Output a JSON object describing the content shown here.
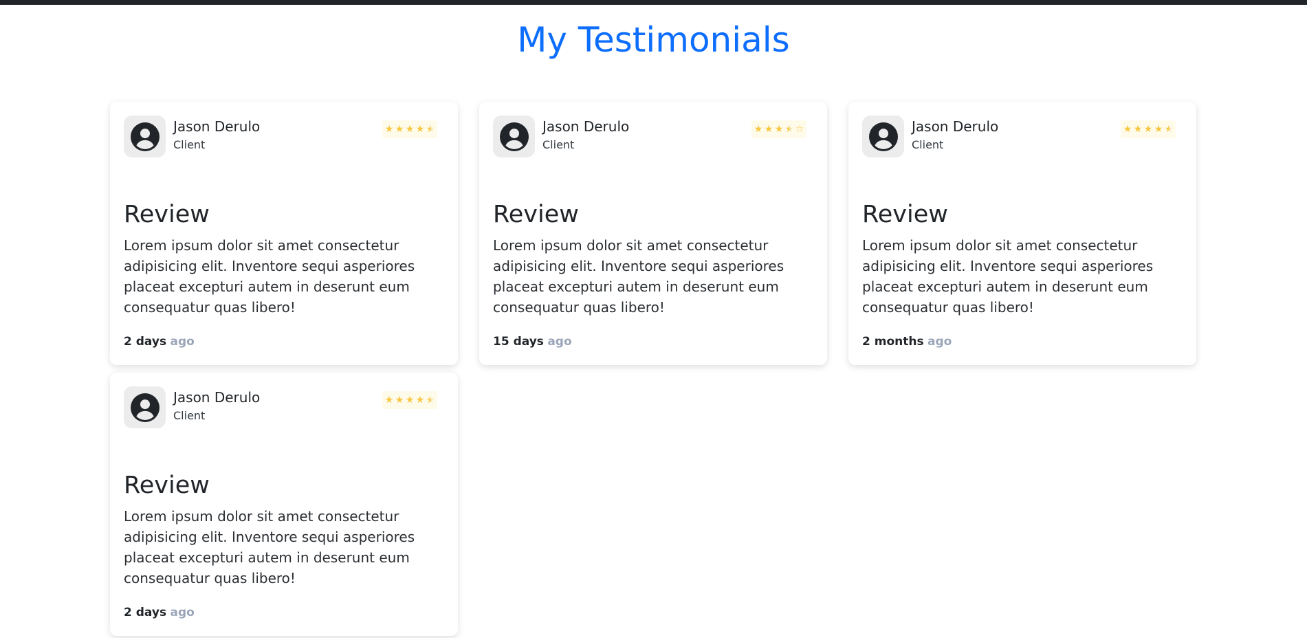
{
  "page": {
    "title": "My Testimonials",
    "accent_color": "#0d6efd",
    "star_color": "#f8c73f"
  },
  "testimonials": [
    {
      "name": "Jason Derulo",
      "role": "Client",
      "rating": 4.5,
      "rating_max": 5,
      "review_title": "Review",
      "review_text": "Lorem ipsum dolor sit amet consectetur adipisicing elit. Inventore sequi asperiores placeat excepturi autem in deserunt eum consequatur quas libero!",
      "time_value": "2 days",
      "time_suffix": "ago"
    },
    {
      "name": "Jason Derulo",
      "role": "Client",
      "rating": 3.5,
      "rating_max": 5,
      "review_title": "Review",
      "review_text": "Lorem ipsum dolor sit amet consectetur adipisicing elit. Inventore sequi asperiores placeat excepturi autem in deserunt eum consequatur quas libero!",
      "time_value": "15 days",
      "time_suffix": "ago"
    },
    {
      "name": "Jason Derulo",
      "role": "Client",
      "rating": 4.5,
      "rating_max": 5,
      "review_title": "Review",
      "review_text": "Lorem ipsum dolor sit amet consectetur adipisicing elit. Inventore sequi asperiores placeat excepturi autem in deserunt eum consequatur quas libero!",
      "time_value": "2 months",
      "time_suffix": "ago"
    },
    {
      "name": "Jason Derulo",
      "role": "Client",
      "rating": 4.5,
      "rating_max": 5,
      "review_title": "Review",
      "review_text": "Lorem ipsum dolor sit amet consectetur adipisicing elit. Inventore sequi asperiores placeat excepturi autem in deserunt eum consequatur quas libero!",
      "time_value": "2 days",
      "time_suffix": "ago"
    }
  ]
}
